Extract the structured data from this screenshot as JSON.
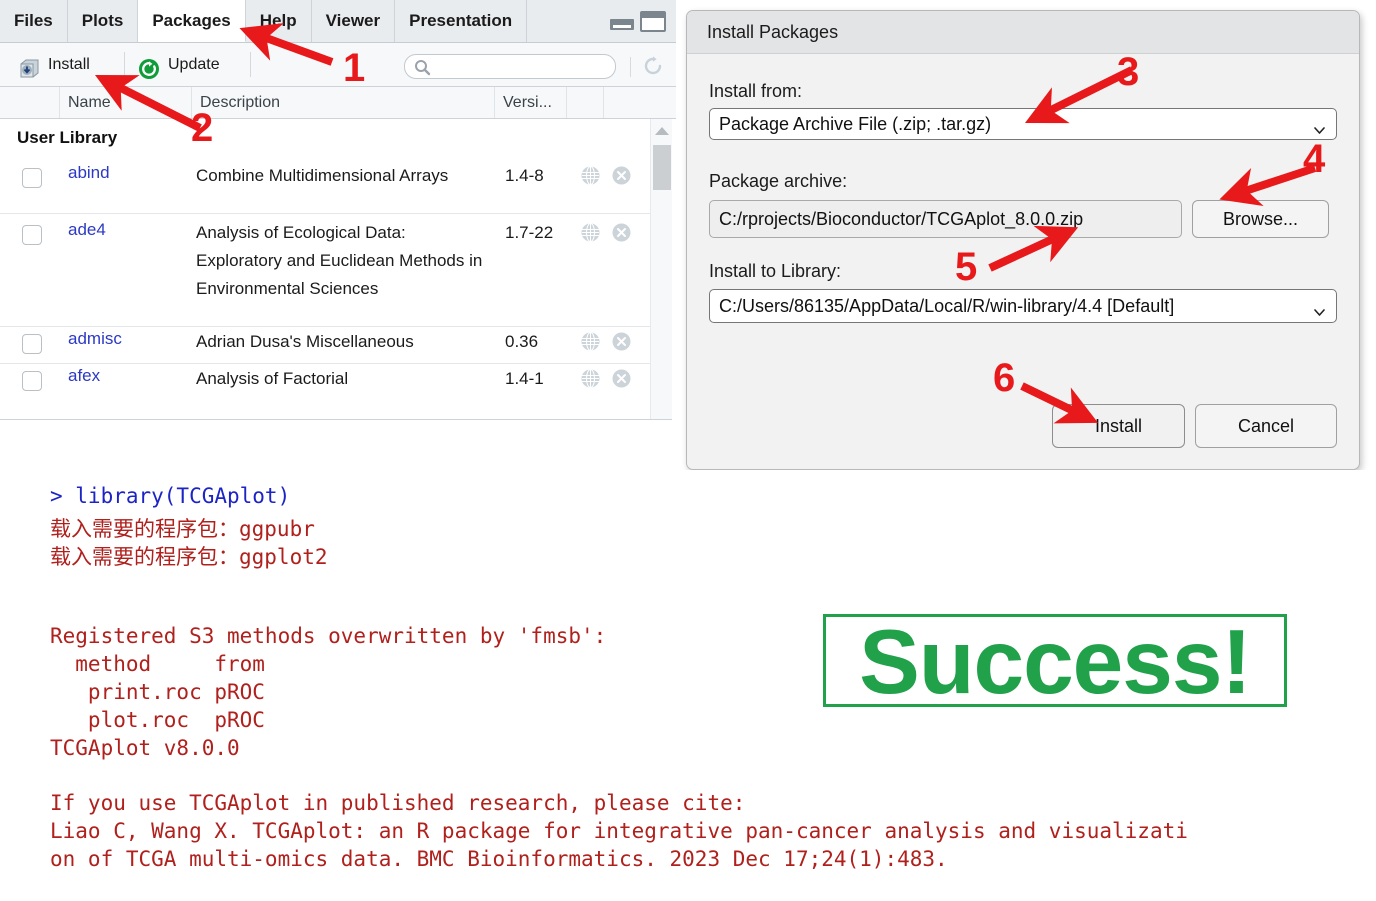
{
  "packages_pane": {
    "tabs": [
      {
        "label": "Files",
        "active": false
      },
      {
        "label": "Plots",
        "active": false
      },
      {
        "label": "Packages",
        "active": true
      },
      {
        "label": "Help",
        "active": false
      },
      {
        "label": "Viewer",
        "active": false
      },
      {
        "label": "Presentation",
        "active": false
      }
    ],
    "window_controls": {
      "minimize": "minimize-icon",
      "maximize": "maximize-icon"
    },
    "toolbar": {
      "install_label": "Install",
      "install_icon": "install-package-icon",
      "update_label": "Update",
      "update_icon": "update-packages-icon",
      "search_placeholder": "",
      "search_value": "",
      "search_icon": "search-icon",
      "refresh_icon": "refresh-icon"
    },
    "columns": [
      "",
      "Name",
      "Description",
      "Versi...",
      "",
      ""
    ],
    "library_section": "User Library",
    "rows": [
      {
        "name": "abind",
        "description": "Combine Multidimensional Arrays",
        "version": "1.4-8",
        "checked": false
      },
      {
        "name": "ade4",
        "description": "Analysis of Ecological Data: Exploratory and Euclidean Methods in Environmental Sciences",
        "version": "1.7-22",
        "checked": false
      },
      {
        "name": "admisc",
        "description": "Adrian Dusa's Miscellaneous",
        "version": "0.36",
        "checked": false
      },
      {
        "name": "afex",
        "description": "Analysis of Factorial",
        "version": "1.4-1",
        "checked": false
      }
    ],
    "row_icons": {
      "globe": "globe-icon",
      "remove": "remove-package-icon"
    }
  },
  "install_dialog": {
    "title": "Install Packages",
    "install_from_label": "Install from:",
    "install_from_value": "Package Archive File (.zip; .tar.gz)",
    "package_archive_label": "Package archive:",
    "package_archive_value": "C:/rprojects/Bioconductor/TCGAplot_8.0.0.zip",
    "browse_label": "Browse...",
    "install_to_library_label": "Install to Library:",
    "install_to_library_value": "C:/Users/86135/AppData/Local/R/win-library/4.4 [Default]",
    "install_button": "Install",
    "cancel_button": "Cancel",
    "chevron_icon": "chevron-down-icon"
  },
  "console": {
    "lines": [
      {
        "text": "> library(TCGAplot)",
        "color": "blue"
      },
      {
        "text": "载入需要的程序包：ggpubr",
        "color": "red"
      },
      {
        "text": "载入需要的程序包：ggplot2",
        "color": "red"
      },
      {
        "text": "Registered S3 methods overwritten by 'fmsb':",
        "color": "red"
      },
      {
        "text": "  method     from",
        "color": "red"
      },
      {
        "text": "   print.roc pROC",
        "color": "red"
      },
      {
        "text": "   plot.roc  pROC",
        "color": "red"
      },
      {
        "text": "TCGAplot v8.0.0",
        "color": "red"
      },
      {
        "text": "If you use TCGAplot in published research, please cite:",
        "color": "red"
      },
      {
        "text": "Liao C, Wang X. TCGAplot: an R package for integrative pan-cancer analysis and visualizati",
        "color": "red"
      },
      {
        "text": "on of TCGA multi-omics data. BMC Bioinformatics. 2023 Dec 17;24(1):483.",
        "color": "red"
      }
    ]
  },
  "success_banner": {
    "text": "Success!",
    "color": "#22a14b"
  },
  "annotations": {
    "arrow_color": "#e8191b",
    "steps": [
      {
        "number": "1",
        "target": "packages-tab"
      },
      {
        "number": "2",
        "target": "install-button"
      },
      {
        "number": "3",
        "target": "install-from-select"
      },
      {
        "number": "4",
        "target": "browse-button"
      },
      {
        "number": "5",
        "target": "package-archive-field"
      },
      {
        "number": "6",
        "target": "install-dialog-button"
      }
    ]
  }
}
